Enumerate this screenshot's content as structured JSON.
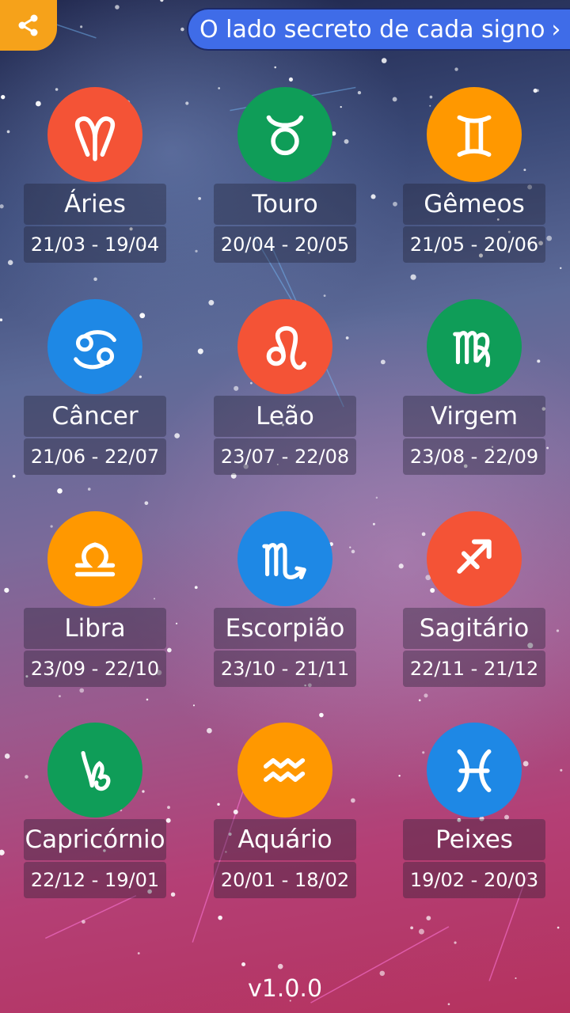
{
  "header": {
    "share_icon": "share-icon",
    "promo_label": "O lado secreto de cada signo",
    "promo_chevron": "›",
    "share_color": "#f6a21a",
    "promo_color": "#3f6ce8"
  },
  "signs": [
    {
      "name": "Áries",
      "dates": "21/03 - 19/04",
      "icon": "aries-icon",
      "color": "#f45336"
    },
    {
      "name": "Touro",
      "dates": "20/04 - 20/05",
      "icon": "taurus-icon",
      "color": "#0f9d58"
    },
    {
      "name": "Gêmeos",
      "dates": "21/05 - 20/06",
      "icon": "gemini-icon",
      "color": "#ff9800"
    },
    {
      "name": "Câncer",
      "dates": "21/06 - 22/07",
      "icon": "cancer-icon",
      "color": "#1e88e5"
    },
    {
      "name": "Leão",
      "dates": "23/07 - 22/08",
      "icon": "leo-icon",
      "color": "#f45336"
    },
    {
      "name": "Virgem",
      "dates": "23/08 - 22/09",
      "icon": "virgo-icon",
      "color": "#0f9d58"
    },
    {
      "name": "Libra",
      "dates": "23/09 - 22/10",
      "icon": "libra-icon",
      "color": "#ff9800"
    },
    {
      "name": "Escorpião",
      "dates": "23/10 - 21/11",
      "icon": "scorpio-icon",
      "color": "#1e88e5"
    },
    {
      "name": "Sagitário",
      "dates": "22/11 - 21/12",
      "icon": "sagittarius-icon",
      "color": "#f45336"
    },
    {
      "name": "Capricórnio",
      "dates": "22/12 - 19/01",
      "icon": "capricorn-icon",
      "color": "#0f9d58"
    },
    {
      "name": "Aquário",
      "dates": "20/01 - 18/02",
      "icon": "aquarius-icon",
      "color": "#ff9800"
    },
    {
      "name": "Peixes",
      "dates": "19/02 - 20/03",
      "icon": "pisces-icon",
      "color": "#1e88e5"
    }
  ],
  "footer": {
    "version": "v1.0.0"
  }
}
